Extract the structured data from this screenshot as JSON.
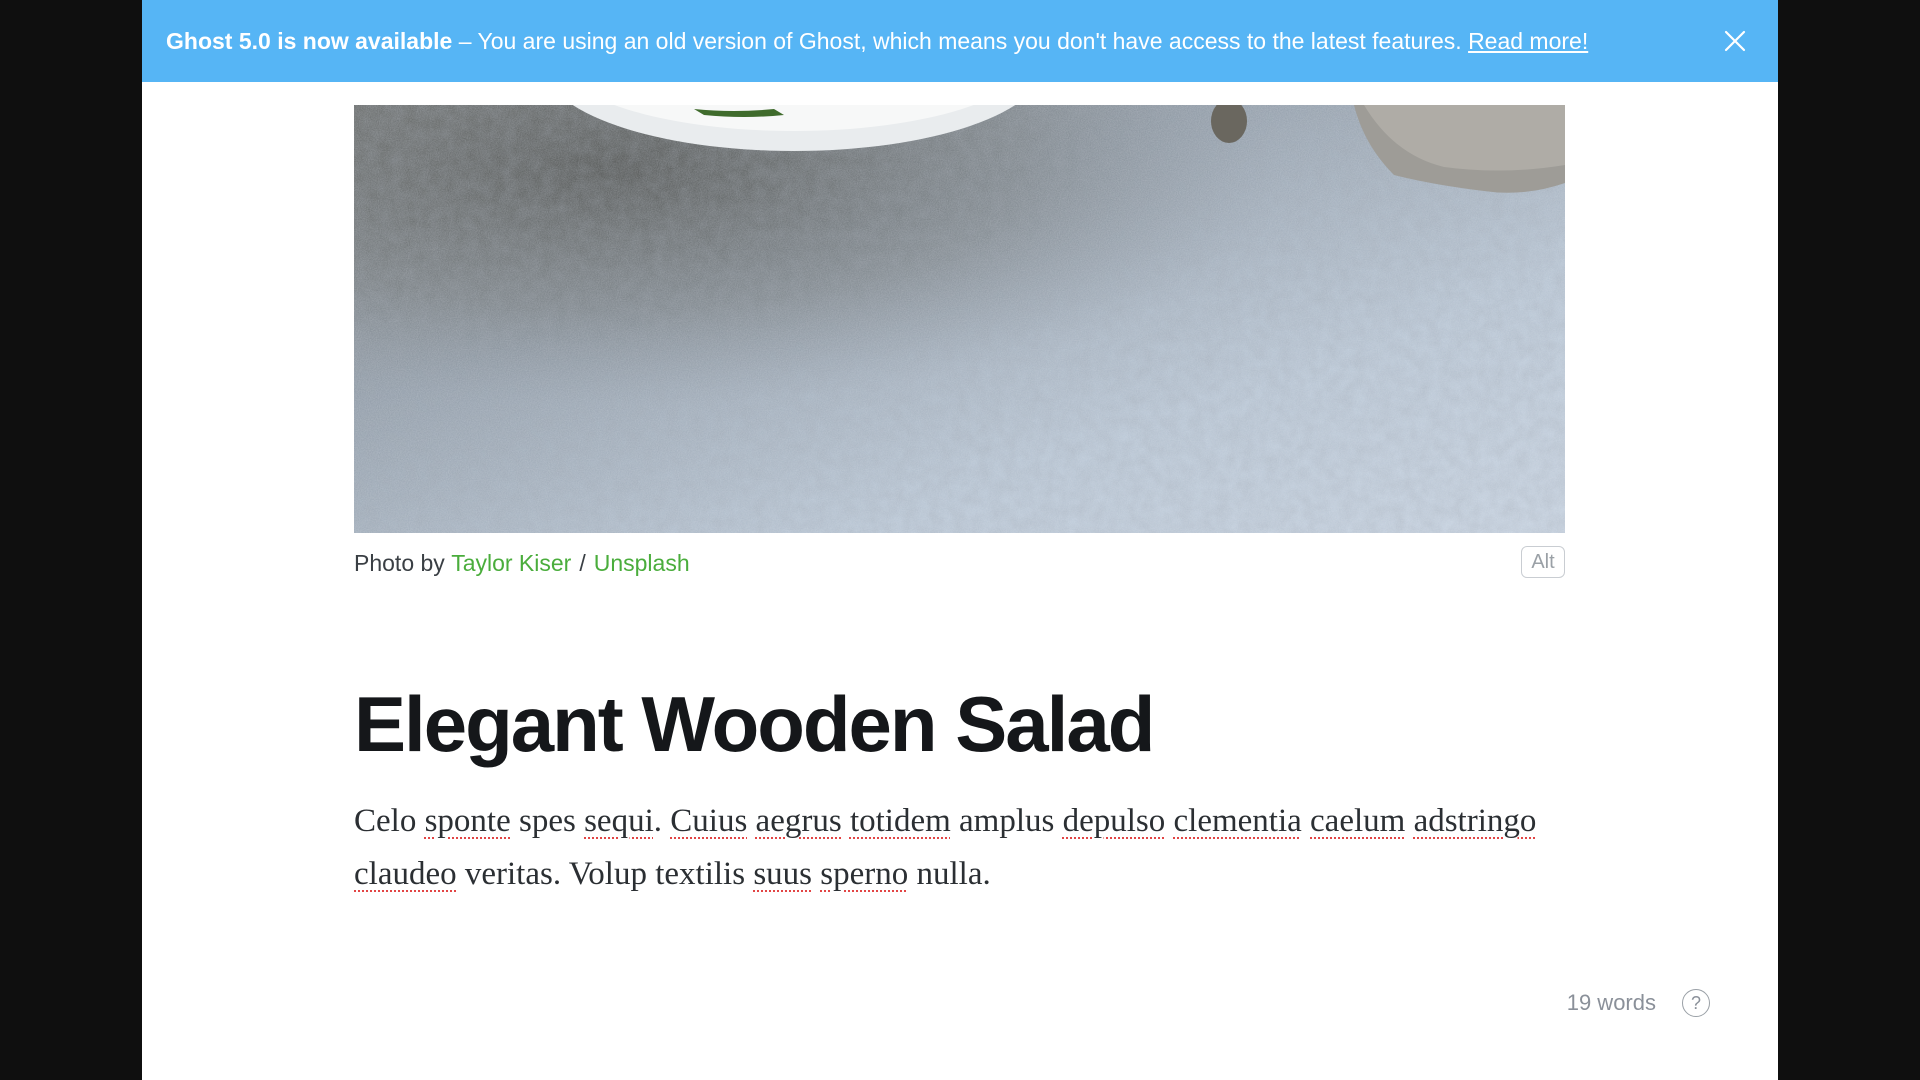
{
  "banner": {
    "headline": "Ghost 5.0 is now available",
    "message": " – You are using an old version of Ghost, which means you don't have access to the latest features. ",
    "link_label": "Read more!",
    "background": "#56b5f5",
    "close_icon": "close-icon"
  },
  "feature_image": {
    "caption_prefix": "Photo by",
    "photographer": "Taylor Kiser",
    "separator": "/",
    "source": "Unsplash",
    "alt_button_label": "Alt"
  },
  "post": {
    "title": "Elegant Wooden Salad",
    "body": [
      {
        "text": "Celo ",
        "misspelled": false
      },
      {
        "text": "sponte",
        "misspelled": true
      },
      {
        "text": " spes ",
        "misspelled": false
      },
      {
        "text": "sequi",
        "misspelled": true
      },
      {
        "text": ". ",
        "misspelled": false
      },
      {
        "text": "Cuius",
        "misspelled": true
      },
      {
        "text": " ",
        "misspelled": false
      },
      {
        "text": "aegrus",
        "misspelled": true
      },
      {
        "text": " ",
        "misspelled": false
      },
      {
        "text": "totidem",
        "misspelled": true
      },
      {
        "text": " amplus ",
        "misspelled": false
      },
      {
        "text": "depulso",
        "misspelled": true
      },
      {
        "text": " ",
        "misspelled": false
      },
      {
        "text": "clementia",
        "misspelled": true
      },
      {
        "text": " ",
        "misspelled": false
      },
      {
        "text": "caelum",
        "misspelled": true
      },
      {
        "text": " ",
        "misspelled": false
      },
      {
        "text": "adstringo",
        "misspelled": true
      },
      {
        "text": " ",
        "misspelled": false
      },
      {
        "text": "claudeo",
        "misspelled": true
      },
      {
        "text": " veritas. Volup textilis ",
        "misspelled": false
      },
      {
        "text": "suus",
        "misspelled": true
      },
      {
        "text": " ",
        "misspelled": false
      },
      {
        "text": "sperno",
        "misspelled": true
      },
      {
        "text": " nulla.",
        "misspelled": false
      }
    ]
  },
  "footer": {
    "word_count": "19 words",
    "help_icon": "help-icon",
    "help_glyph": "?"
  },
  "colors": {
    "accent_green": "#4aad3c",
    "banner_blue": "#56b5f5",
    "spellcheck_red": "#e24545"
  }
}
